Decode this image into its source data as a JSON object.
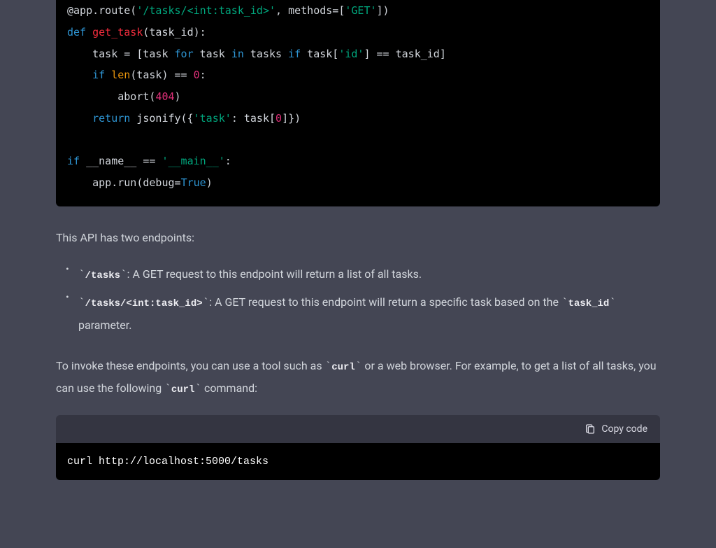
{
  "code1": {
    "line1": {
      "prefix": "@app.route(",
      "route": "'/tasks/<int:task_id>'",
      "mid": ", methods=[",
      "method": "'GET'",
      "suffix": "])"
    },
    "line2": {
      "def": "def",
      "func": "get_task",
      "params": "(task_id):"
    },
    "line3": {
      "indent": "    ",
      "a": "task = [task ",
      "for": "for",
      "b": " task ",
      "in": "in",
      "c": " tasks ",
      "if": "if",
      "d": " task[",
      "key": "'id'",
      "e": "] == task_id]"
    },
    "line4": {
      "indent": "    ",
      "if": "if",
      "sp": " ",
      "len": "len",
      "a": "(task) == ",
      "num": "0",
      "colon": ":"
    },
    "line5": {
      "indent": "        ",
      "abort": "abort(",
      "num": "404",
      "close": ")"
    },
    "line6": {
      "indent": "    ",
      "return": "return",
      "sp": " ",
      "a": "jsonify({",
      "key": "'task'",
      "b": ": task[",
      "num": "0",
      "c": "]})"
    },
    "line7": "",
    "line8": {
      "if": "if",
      "a": " __name__ == ",
      "main": "'__main__'",
      "colon": ":"
    },
    "line9": {
      "indent": "    ",
      "a": "app.run(debug=",
      "true": "True",
      "close": ")"
    }
  },
  "text1": "This API has two endpoints:",
  "bullets": {
    "b1": {
      "code": "/tasks",
      "text": ": A GET request to this endpoint will return a list of all tasks."
    },
    "b2": {
      "code": "/tasks/<int:task_id>",
      "text_a": ": A GET request to this endpoint will return a specific task based on the ",
      "code2": "task_id",
      "text_b": " parameter."
    }
  },
  "text2": {
    "a": "To invoke these endpoints, you can use a tool such as ",
    "code1": "curl",
    "b": " or a web browser. For example, to get a list of all tasks, you can use the following ",
    "code2": "curl",
    "c": " command:"
  },
  "copy_label": "Copy code",
  "code2": "curl http://localhost:5000/tasks",
  "backtick": "`"
}
